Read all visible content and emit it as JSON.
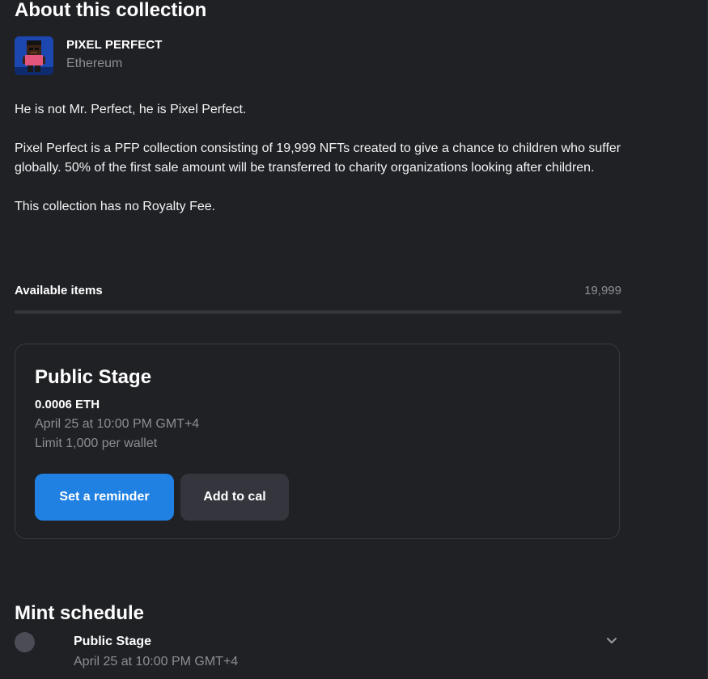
{
  "about": {
    "title": "About this collection"
  },
  "collection": {
    "name": "PIXEL PERFECT",
    "chain": "Ethereum",
    "avatar_icon": "pixel-character-avatar"
  },
  "description": {
    "paragraphs": [
      "He is not Mr. Perfect, he is Pixel Perfect.",
      "Pixel Perfect is a PFP collection consisting of 19,999 NFTs created to give a chance to children who suffer globally. 50% of the first sale amount will be transferred to charity organizations looking after children.",
      "This collection has no Royalty Fee."
    ]
  },
  "availability": {
    "label": "Available items",
    "count": "19,999",
    "progress_fraction": 0
  },
  "stage_card": {
    "title": "Public Stage",
    "price": "0.0006 ETH",
    "date": "April 25 at 10:00 PM GMT+4",
    "limit": "Limit 1,000 per wallet",
    "reminder_label": "Set a reminder",
    "calendar_label": "Add to cal"
  },
  "mint_schedule": {
    "title": "Mint schedule",
    "items": [
      {
        "name": "Public Stage",
        "date": "April 25 at 10:00 PM GMT+4",
        "expand_icon": "chevron-down-icon"
      }
    ]
  },
  "colors": {
    "background": "#202125",
    "accent": "#2081e2",
    "secondary_button": "#35363d",
    "muted_text": "#8d8e95",
    "border": "#393a40"
  }
}
